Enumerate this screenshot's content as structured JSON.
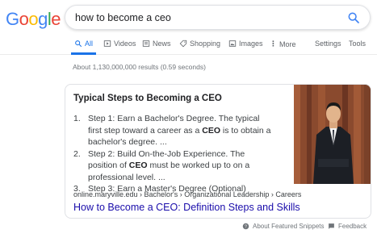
{
  "logo": {
    "letters": [
      "G",
      "o",
      "o",
      "g",
      "l",
      "e"
    ],
    "colors": [
      "#4285F4",
      "#EA4335",
      "#FBBC05",
      "#4285F4",
      "#34A853",
      "#EA4335"
    ]
  },
  "search": {
    "query": "how to become a ceo"
  },
  "tabs": [
    {
      "label": "All",
      "icon": "search-icon"
    },
    {
      "label": "Videos",
      "icon": "video-icon"
    },
    {
      "label": "News",
      "icon": "news-icon"
    },
    {
      "label": "Shopping",
      "icon": "tag-icon"
    },
    {
      "label": "Images",
      "icon": "image-icon"
    },
    {
      "label": "More",
      "icon": "more-icon"
    }
  ],
  "tools": {
    "settings": "Settings",
    "tools": "Tools"
  },
  "stats": "About 1,130,000,000 results (0.59 seconds)",
  "snippet": {
    "title": "Typical Steps to Becoming a CEO",
    "steps": [
      {
        "num": "1.",
        "pre": "Step 1: Earn a Bachelor's Degree. The typical first step toward a career as a ",
        "bold": "CEO",
        "post": " is to obtain a bachelor's degree. ..."
      },
      {
        "num": "2.",
        "pre": "Step 2: Build On-the-Job Experience. The position of ",
        "bold": "CEO",
        "post": " must be worked up to on a professional level. ..."
      },
      {
        "num": "3.",
        "pre": "Step 3: Earn a Master's Degree (Optional)",
        "bold": "",
        "post": ""
      }
    ],
    "breadcrumb": "online.maryville.edu › Bachelor's › Organizational Leadership › Careers",
    "link": "How to Become a CEO: Definition Steps and Skills"
  },
  "footer": {
    "about": "About Featured Snippets",
    "feedback": "Feedback"
  },
  "colors": {
    "accent": "#1a73e8",
    "link": "#1a0dab"
  }
}
